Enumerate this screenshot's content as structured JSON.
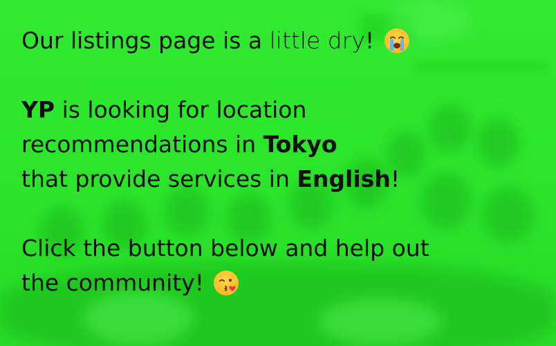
{
  "banner": {
    "background_color": "#2ce62c",
    "text_color": "#101010",
    "line1": {
      "part1": "Our listings page is a",
      "part2": "little dry",
      "part3": "!",
      "emoji": "loudly-crying-face-icon"
    },
    "line2": {
      "part1": "YP",
      "part2": " is looking for location"
    },
    "line3": {
      "part1": "recommendations in ",
      "part2": "Tokyo"
    },
    "line4": {
      "part1": "that provide services in ",
      "part2": "English",
      "part3": "!"
    },
    "line5": {
      "text": "Click the button below and help out"
    },
    "line6": {
      "text": "the community!",
      "emoji": "face-blowing-kiss-icon"
    }
  }
}
